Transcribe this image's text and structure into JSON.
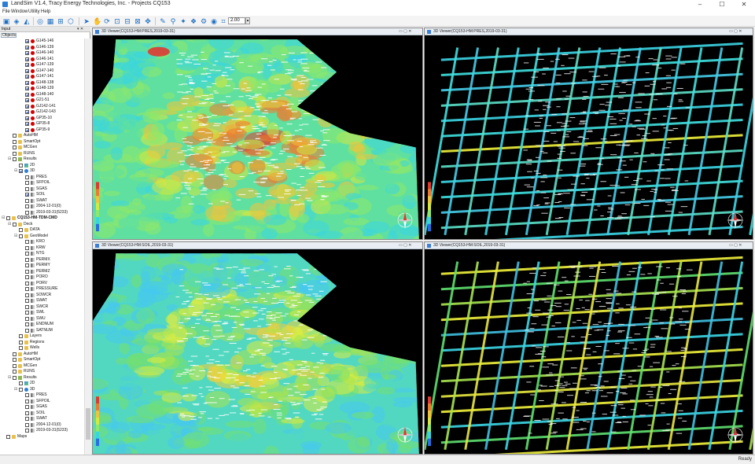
{
  "window": {
    "title": "LandSim V1.4, Tracy Energy Technologies, Inc. - Projects CQ153",
    "minimize": "–",
    "maximize": "☐",
    "close": "✕"
  },
  "menu": [
    "File",
    "Window",
    "Utility",
    "Help"
  ],
  "toolbar": {
    "zoom_value": "2.00"
  },
  "panel": {
    "title": "Input",
    "tab": "Objects",
    "pin_btn": "▾ ✕"
  },
  "tree": [
    {
      "label": "G145-146",
      "indent": 3,
      "icon": "well",
      "checked": true
    },
    {
      "label": "G146-139",
      "indent": 3,
      "icon": "well",
      "checked": true
    },
    {
      "label": "G146-140",
      "indent": 3,
      "icon": "well",
      "checked": true
    },
    {
      "label": "G146-141",
      "indent": 3,
      "icon": "well",
      "checked": true
    },
    {
      "label": "G147-139",
      "indent": 3,
      "icon": "well",
      "checked": true
    },
    {
      "label": "G147-140",
      "indent": 3,
      "icon": "well",
      "checked": true
    },
    {
      "label": "G147-141",
      "indent": 3,
      "icon": "well",
      "checked": true
    },
    {
      "label": "G148-138",
      "indent": 3,
      "icon": "well",
      "checked": true
    },
    {
      "label": "G148-139",
      "indent": 3,
      "icon": "well",
      "checked": true
    },
    {
      "label": "G148-140",
      "indent": 3,
      "icon": "well",
      "checked": true
    },
    {
      "label": "G21-51",
      "indent": 3,
      "icon": "well",
      "checked": true
    },
    {
      "label": "GJ142-141",
      "indent": 3,
      "icon": "well",
      "checked": true
    },
    {
      "label": "GJ142-143",
      "indent": 3,
      "icon": "well",
      "checked": true
    },
    {
      "label": "GP35-10",
      "indent": 3,
      "icon": "well",
      "checked": true
    },
    {
      "label": "GP35-8",
      "indent": 3,
      "icon": "well",
      "checked": true
    },
    {
      "label": "GP35-9",
      "indent": 3,
      "icon": "well",
      "checked": true
    },
    {
      "label": "AutoHM",
      "indent": 1,
      "icon": "folder",
      "checked": false
    },
    {
      "label": "SmartOpt",
      "indent": 1,
      "icon": "folder",
      "checked": false
    },
    {
      "label": "MCGen",
      "indent": 1,
      "icon": "folder",
      "checked": false
    },
    {
      "label": "RUNS",
      "indent": 1,
      "icon": "folder",
      "checked": false
    },
    {
      "label": "Results",
      "indent": 1,
      "icon": "res",
      "checked": false,
      "expand": "⊟"
    },
    {
      "label": "2D",
      "indent": 2,
      "icon": "grid",
      "checked": false
    },
    {
      "label": "3D",
      "indent": 2,
      "icon": "globe",
      "checked": true,
      "expand": "⊟"
    },
    {
      "label": "PRES",
      "indent": 3,
      "icon": "prop",
      "checked": false
    },
    {
      "label": "SFPOIL",
      "indent": 3,
      "icon": "prop",
      "checked": false
    },
    {
      "label": "SGAS",
      "indent": 3,
      "icon": "prop",
      "checked": false
    },
    {
      "label": "SOIL",
      "indent": 3,
      "icon": "prop",
      "checked": true
    },
    {
      "label": "SWAT",
      "indent": 3,
      "icon": "prop",
      "checked": false
    },
    {
      "label": "2004-12-01(0)",
      "indent": 3,
      "icon": "prop",
      "checked": false
    },
    {
      "label": "2019-03-31(5233)",
      "indent": 3,
      "icon": "prop",
      "checked": false
    },
    {
      "label": "CQ153-HM-TDM-CMD",
      "indent": 0,
      "icon": "folder",
      "checked": false,
      "bold": true,
      "expand": "⊟"
    },
    {
      "label": "Deck",
      "indent": 1,
      "icon": "folder",
      "checked": false,
      "expand": "⊟"
    },
    {
      "label": "DATA",
      "indent": 2,
      "icon": "folder",
      "checked": false
    },
    {
      "label": "GeoModel",
      "indent": 2,
      "icon": "folder",
      "checked": false,
      "expand": "⊟"
    },
    {
      "label": "KRO",
      "indent": 3,
      "icon": "prop",
      "checked": false
    },
    {
      "label": "KRW",
      "indent": 3,
      "icon": "prop",
      "checked": false
    },
    {
      "label": "NTG",
      "indent": 3,
      "icon": "prop",
      "checked": false
    },
    {
      "label": "PERMX",
      "indent": 3,
      "icon": "prop",
      "checked": false
    },
    {
      "label": "PERMY",
      "indent": 3,
      "icon": "prop",
      "checked": false
    },
    {
      "label": "PERMZ",
      "indent": 3,
      "icon": "prop",
      "checked": false
    },
    {
      "label": "PORO",
      "indent": 3,
      "icon": "prop",
      "checked": false
    },
    {
      "label": "PORV",
      "indent": 3,
      "icon": "prop",
      "checked": false
    },
    {
      "label": "PRESSURE",
      "indent": 3,
      "icon": "prop",
      "checked": false
    },
    {
      "label": "SOWCR",
      "indent": 3,
      "icon": "prop",
      "checked": false
    },
    {
      "label": "SWAT",
      "indent": 3,
      "icon": "prop",
      "checked": false
    },
    {
      "label": "SWCR",
      "indent": 3,
      "icon": "prop",
      "checked": false
    },
    {
      "label": "SWL",
      "indent": 3,
      "icon": "prop",
      "checked": false
    },
    {
      "label": "SWU",
      "indent": 3,
      "icon": "prop",
      "checked": false
    },
    {
      "label": "ENDNUM",
      "indent": 3,
      "icon": "prop",
      "checked": false
    },
    {
      "label": "SATNUM",
      "indent": 3,
      "icon": "prop",
      "checked": false
    },
    {
      "label": "Layers",
      "indent": 2,
      "icon": "folder",
      "checked": false
    },
    {
      "label": "Regions",
      "indent": 2,
      "icon": "folder",
      "checked": false
    },
    {
      "label": "Wells",
      "indent": 2,
      "icon": "folder",
      "checked": false
    },
    {
      "label": "AutoHM",
      "indent": 1,
      "icon": "folder",
      "checked": false
    },
    {
      "label": "SmartOpt",
      "indent": 1,
      "icon": "folder",
      "checked": false
    },
    {
      "label": "MCGen",
      "indent": 1,
      "icon": "folder",
      "checked": false
    },
    {
      "label": "RUNS",
      "indent": 1,
      "icon": "folder",
      "checked": false
    },
    {
      "label": "Results",
      "indent": 1,
      "icon": "res",
      "checked": false,
      "expand": "⊟"
    },
    {
      "label": "2D",
      "indent": 2,
      "icon": "grid",
      "checked": false
    },
    {
      "label": "3D",
      "indent": 2,
      "icon": "globe",
      "checked": false,
      "expand": "⊟"
    },
    {
      "label": "PRES",
      "indent": 3,
      "icon": "prop",
      "checked": false
    },
    {
      "label": "SFPOIL",
      "indent": 3,
      "icon": "prop",
      "checked": false
    },
    {
      "label": "SGAS",
      "indent": 3,
      "icon": "prop",
      "checked": false
    },
    {
      "label": "SOIL",
      "indent": 3,
      "icon": "prop",
      "checked": false
    },
    {
      "label": "SWAT",
      "indent": 3,
      "icon": "prop",
      "checked": false
    },
    {
      "label": "2004-12-01(0)",
      "indent": 3,
      "icon": "prop",
      "checked": false
    },
    {
      "label": "2019-03-31(5233)",
      "indent": 3,
      "icon": "prop",
      "checked": false
    },
    {
      "label": "Maps",
      "indent": 0,
      "icon": "folder",
      "checked": false
    }
  ],
  "viewers": [
    {
      "title": "3D Viewer(CQ153-HM:PRES,2019-03-31)",
      "mode": "surface",
      "palette": "pres"
    },
    {
      "title": "3D Viewer(CQ153-HM:PRES,2019-03-31)",
      "mode": "grid",
      "palette": "cyan"
    },
    {
      "title": "3D Viewer(CQ153-HM:SOIL,2019-03-31)",
      "mode": "surface",
      "palette": "soil"
    },
    {
      "title": "3D Viewer(CQ153-HM:SOIL,2019-03-31)",
      "mode": "grid",
      "palette": "mixed"
    }
  ],
  "viewer_buttons": "▭ ▢ ✕",
  "colors": {
    "cyan": "#3cd6e6",
    "green": "#5fe070",
    "yellow": "#f2f23c",
    "red": "#e83030",
    "blue": "#2a6fe0"
  },
  "status": {
    "text": "Ready"
  }
}
